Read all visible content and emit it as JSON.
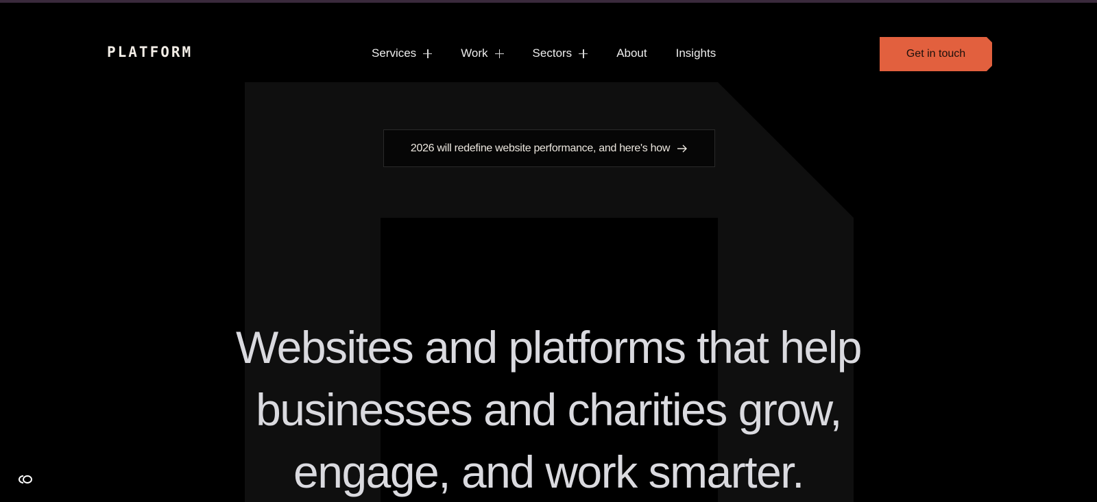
{
  "header": {
    "logo": "PLATFORM",
    "nav": [
      {
        "label": "Services",
        "has_submenu": true
      },
      {
        "label": "Work",
        "has_submenu": true
      },
      {
        "label": "Sectors",
        "has_submenu": true
      },
      {
        "label": "About",
        "has_submenu": false
      },
      {
        "label": "Insights",
        "has_submenu": false
      }
    ],
    "cta_label": "Get in touch"
  },
  "announcement": {
    "text": "2026 will redefine website performance, and here's how",
    "icon": "arrow-right-icon"
  },
  "hero": {
    "lines": [
      "Websites and platforms that help",
      "businesses and charities grow,",
      "engage, and work smarter."
    ]
  },
  "cookie_button": {
    "icon": "cookie-settings-icon"
  },
  "colors": {
    "background": "#000000",
    "accent": "#e2603e",
    "hero_text": "#dadadf",
    "mark": "#0f0f0f"
  }
}
